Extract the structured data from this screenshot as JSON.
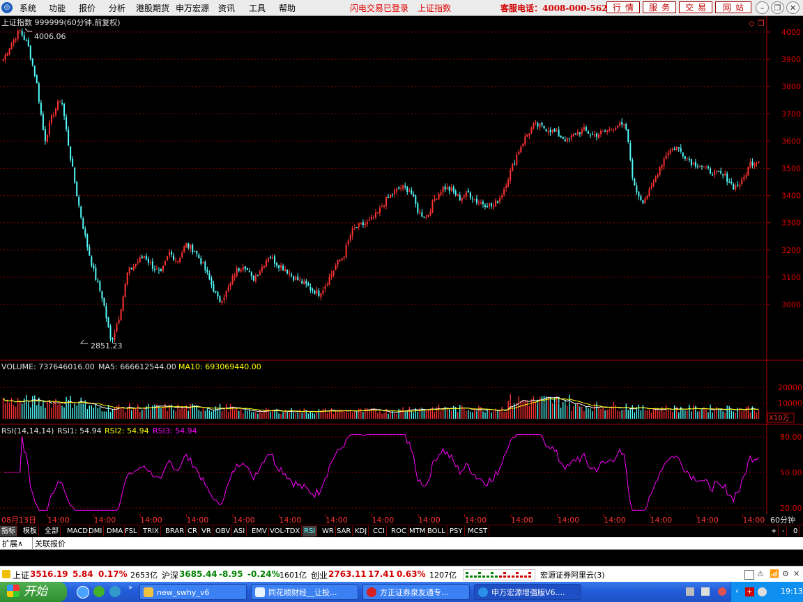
{
  "menu": {
    "items": [
      "系统",
      "功能",
      "报价",
      "分析",
      "港股期货",
      "申万宏源",
      "资讯",
      "工具",
      "帮助"
    ],
    "flash": "闪电交易已登录",
    "index_name": "上证指数",
    "hotline": "客服电话：4008-000-562",
    "tabs": [
      "行情",
      "服务",
      "交易",
      "网站"
    ]
  },
  "chart": {
    "header": "上证指数 999999(60分钟,前复权)",
    "max_label": "4006.06",
    "min_label": "2851.23",
    "price_ticks": [
      "4000",
      "3900",
      "3800",
      "3700",
      "3600",
      "3500",
      "3400",
      "3300",
      "3200",
      "3100",
      "3000"
    ],
    "volume_label": "VOLUME: 737646016.00",
    "ma5_label": "MA5: 666612544.00",
    "ma10_label": "MA10: 693069440.00",
    "volume_ticks": [
      "20000",
      "10000"
    ],
    "volume_unit": "X10万",
    "rsi_label": "RSI(14,14,14)",
    "rsi1_label": "RSI1: 54.94",
    "rsi2_label": "RSI2: 54.94",
    "rsi3_label": "RSI3: 54.94",
    "rsi_ticks": [
      "80.00",
      "50.00",
      "20.00"
    ],
    "colors": {
      "up": "#ff3232",
      "down": "#54fcfc",
      "ma5": "#ffffff",
      "ma10": "#ffff00",
      "rsi": "#ff00ff",
      "grid": "#8b0000"
    }
  },
  "timebar": {
    "first": "08月13日",
    "label": "14:00",
    "count": 16,
    "period": "60分钟"
  },
  "indicators": [
    "指标",
    "模板",
    "全部",
    "MACD",
    "DMI",
    "DMA",
    "FSL",
    "TRIX",
    "BRAR",
    "CR",
    "VR",
    "OBV",
    "ASI",
    "EMV",
    "VOL-TDX",
    "RSI",
    "WR",
    "SAR",
    "KDJ",
    "CCI",
    "ROC",
    "MTM",
    "BOLL",
    "PSY",
    "MCST"
  ],
  "ind_controls": [
    "+",
    "-",
    "0"
  ],
  "ext": [
    "扩展∧",
    "关联报价"
  ],
  "status": {
    "sh_name": "上证",
    "sh_val": "3516.19",
    "sh_chg": "5.84",
    "sh_pct": "0.17%",
    "sh_amt": "2653亿",
    "hs_name": "沪深",
    "hs_val": "3685.44",
    "hs_chg": "-8.95",
    "hs_pct": "-0.24%",
    "hs_amt": "1601亿",
    "cy_name": "创业",
    "cy_val": "2763.11",
    "cy_chg": "17.41",
    "cy_pct": "0.63%",
    "cy_amt": "1207亿",
    "server": "宏源证券阿里云(3)"
  },
  "taskbar": {
    "start": "开始",
    "windows": [
      "new_swhy_v6",
      "同花顺财经__让投...",
      "方正证券泉友通专...",
      "申万宏源增强版V6...."
    ],
    "clock": "19:13"
  },
  "chart_data": {
    "type": "candlestick",
    "period": "60min",
    "price_axis": [
      3000,
      4000
    ],
    "high_marker": 4006.06,
    "low_marker": 2851.23,
    "close_series_approx": [
      3900,
      3960,
      4006,
      3950,
      3820,
      3600,
      3700,
      3760,
      3560,
      3380,
      3230,
      3110,
      3020,
      2860,
      2960,
      3120,
      3150,
      3180,
      3140,
      3110,
      3190,
      3160,
      3220,
      3200,
      3150,
      3080,
      3010,
      3050,
      3120,
      3150,
      3090,
      3130,
      3180,
      3150,
      3130,
      3100,
      3080,
      3060,
      3040,
      3080,
      3140,
      3180,
      3270,
      3290,
      3300,
      3330,
      3380,
      3410,
      3430,
      3420,
      3340,
      3320,
      3390,
      3430,
      3420,
      3390,
      3410,
      3380,
      3370,
      3360,
      3400,
      3480,
      3560,
      3620,
      3660,
      3650,
      3640,
      3620,
      3600,
      3630,
      3640,
      3620,
      3630,
      3640,
      3660,
      3650,
      3430,
      3380,
      3420,
      3500,
      3560,
      3580,
      3550,
      3520,
      3510,
      3490,
      3480,
      3470,
      3430,
      3450,
      3520,
      3530
    ],
    "volume_axis": [
      0,
      20000
    ],
    "rsi_axis": [
      20,
      80
    ],
    "last": {
      "volume": 737646016.0,
      "ma5": 666612544.0,
      "ma10": 693069440.0,
      "rsi1": 54.94,
      "rsi2": 54.94,
      "rsi3": 54.94
    }
  }
}
